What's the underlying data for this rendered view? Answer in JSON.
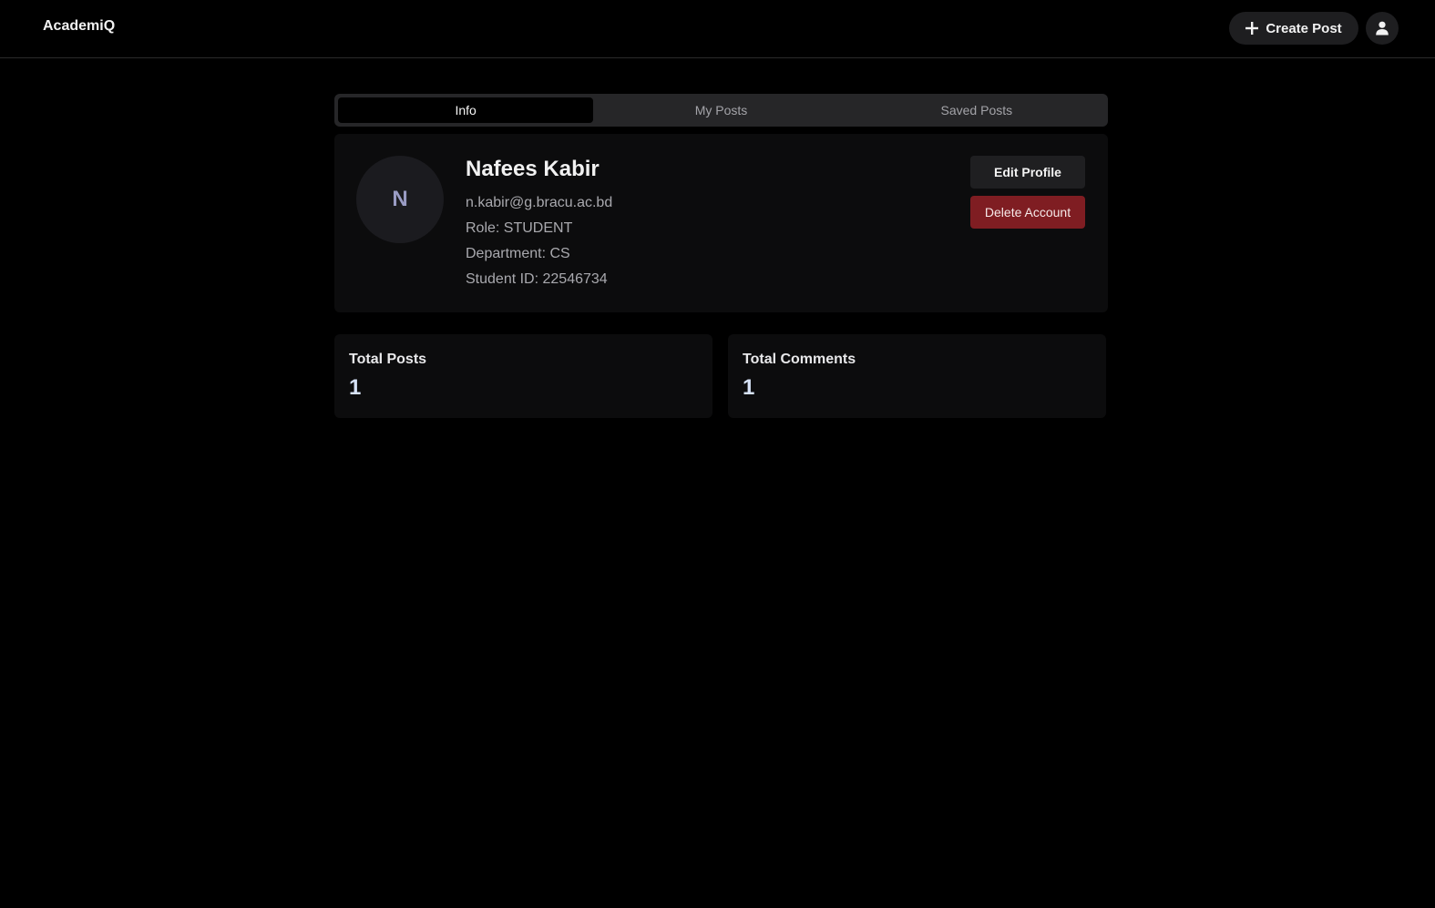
{
  "header": {
    "brand": "AcademiQ",
    "create_post_label": "Create Post",
    "create_post_icon": "plus-icon",
    "user_icon": "user-icon"
  },
  "tabs": [
    {
      "label": "Info",
      "active": true
    },
    {
      "label": "My Posts",
      "active": false
    },
    {
      "label": "Saved Posts",
      "active": false
    }
  ],
  "profile": {
    "avatar_initial": "N",
    "name": "Nafees Kabir",
    "email": "n.kabir@g.bracu.ac.bd",
    "role": "Role: STUDENT",
    "department": "Department: CS",
    "student_id": "Student ID: 22546734",
    "edit_label": "Edit Profile",
    "delete_label": "Delete Account"
  },
  "stats": [
    {
      "label": "Total Posts",
      "value": "1"
    },
    {
      "label": "Total Comments",
      "value": "1"
    }
  ],
  "colors": {
    "background": "#000000",
    "card": "#0c0c0d",
    "danger": "#7f1d22",
    "avatar_text": "#9a9cc4"
  }
}
